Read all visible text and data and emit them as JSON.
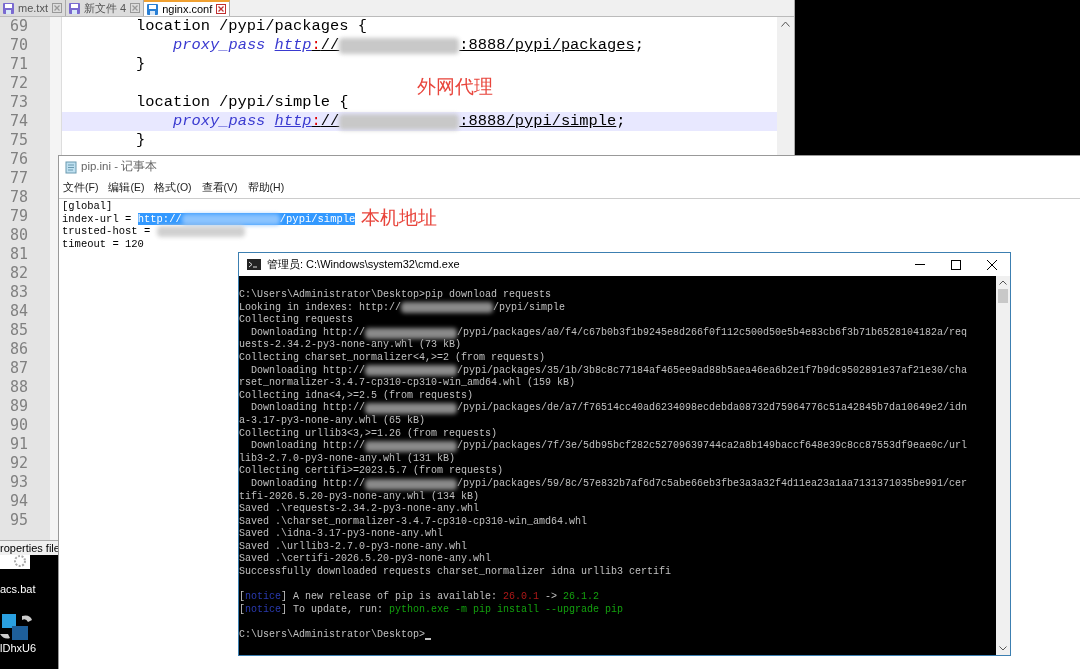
{
  "editor": {
    "tabs": [
      {
        "label": "me.txt",
        "selected": false
      },
      {
        "label": "新文件 4",
        "selected": false
      },
      {
        "label": "nginx.conf",
        "selected": true
      }
    ],
    "lines": [
      {
        "number": "69",
        "kind": "block",
        "selected": false,
        "tokens": [
          {
            "kind": "plain",
            "text": "location /pypi/packages {"
          }
        ]
      },
      {
        "number": "70",
        "kind": "directive",
        "selected": false,
        "tokens": [
          {
            "kind": "keyword",
            "text": "proxy_pass"
          },
          {
            "kind": "scheme",
            "text": "http"
          },
          {
            "kind": "colon",
            "text": ":"
          },
          {
            "kind": "url",
            "text": "//"
          },
          {
            "kind": "redacted"
          },
          {
            "kind": "url",
            "text": ":8888/pypi/packages"
          },
          {
            "kind": "plain",
            "text": ";"
          }
        ]
      },
      {
        "number": "71",
        "kind": "block",
        "selected": false,
        "tokens": [
          {
            "kind": "plain",
            "text": "}"
          }
        ]
      },
      {
        "number": "72",
        "kind": "blank",
        "selected": false
      },
      {
        "number": "73",
        "kind": "block",
        "selected": false,
        "tokens": [
          {
            "kind": "plain",
            "text": "location /pypi/simple {"
          }
        ]
      },
      {
        "number": "74",
        "kind": "directive",
        "selected": true,
        "tokens": [
          {
            "kind": "keyword",
            "text": "proxy_pass"
          },
          {
            "kind": "scheme",
            "text": "http"
          },
          {
            "kind": "colon",
            "text": ":"
          },
          {
            "kind": "url",
            "text": "//"
          },
          {
            "kind": "redacted"
          },
          {
            "kind": "url",
            "text": ":8888/pypi/simple"
          },
          {
            "kind": "plain",
            "text": ";"
          }
        ]
      },
      {
        "number": "75",
        "kind": "block",
        "selected": false,
        "tokens": [
          {
            "kind": "plain",
            "text": "}"
          }
        ]
      }
    ],
    "more_line_numbers": [
      "76",
      "77",
      "78",
      "79",
      "80",
      "81",
      "82",
      "83",
      "84",
      "85",
      "86",
      "87",
      "88",
      "89",
      "90",
      "91",
      "92",
      "93",
      "94",
      "95"
    ],
    "annotation": "外网代理",
    "status_bar": "roperties file"
  },
  "notepad": {
    "title": "pip.ini - 记事本",
    "menu": [
      "文件(F)",
      "编辑(E)",
      "格式(O)",
      "查看(V)",
      "帮助(H)"
    ],
    "lines": [
      [
        {
          "kind": "text",
          "text": "[global]",
          "selected": false
        }
      ],
      [
        {
          "kind": "text",
          "text": "index-url = ",
          "selected": false
        },
        {
          "kind": "text",
          "text": "http://",
          "selected": true
        },
        {
          "kind": "redacted",
          "selected": true
        },
        {
          "kind": "text",
          "text": "/pypi/simple",
          "selected": true
        }
      ],
      [
        {
          "kind": "text",
          "text": "trusted-host = ",
          "selected": false
        },
        {
          "kind": "redacted",
          "selected": false
        }
      ],
      [
        {
          "kind": "text",
          "text": "timeout = 120",
          "selected": false
        }
      ]
    ],
    "annotation": "本机地址"
  },
  "console": {
    "title": "管理员: C:\\Windows\\system32\\cmd.exe",
    "blocks": [
      [
        [
          {
            "kind": "plain",
            "text": "C:\\Users\\Administrator\\Desktop>pip download requests"
          }
        ],
        [
          {
            "kind": "plain",
            "text": "Looking in indexes: http://"
          },
          {
            "kind": "redacted"
          },
          {
            "kind": "plain",
            "text": "/pypi/simple"
          }
        ],
        [
          {
            "kind": "plain",
            "text": "Collecting requests"
          }
        ],
        [
          {
            "kind": "plain",
            "text": "  Downloading http://"
          },
          {
            "kind": "redacted"
          },
          {
            "kind": "plain",
            "text": "/pypi/packages/a0/f4/c67b0b3f1b9245e8d266f0f112c500d50e5b4e83cb6f3b71b6528104182a/req"
          }
        ],
        [
          {
            "kind": "plain",
            "text": "uests-2.34.2-py3-none-any.whl (73 kB)"
          }
        ],
        [
          {
            "kind": "plain",
            "text": "Collecting charset_normalizer<4,>=2 (from requests)"
          }
        ],
        [
          {
            "kind": "plain",
            "text": "  Downloading http://"
          },
          {
            "kind": "redacted"
          },
          {
            "kind": "plain",
            "text": "/pypi/packages/35/1b/3b8c8c77184af465ee9ad88b5aea46ea6b2e1f7b9dc9502891e37af21e30/cha"
          }
        ],
        [
          {
            "kind": "plain",
            "text": "rset_normalizer-3.4.7-cp310-cp310-win_amd64.whl (159 kB)"
          }
        ],
        [
          {
            "kind": "plain",
            "text": "Collecting idna<4,>=2.5 (from requests)"
          }
        ],
        [
          {
            "kind": "plain",
            "text": "  Downloading http://"
          },
          {
            "kind": "redacted"
          },
          {
            "kind": "plain",
            "text": "/pypi/packages/de/a7/f76514cc40ad6234098ecdebda08732d75964776c51a42845b7da10649e2/idn"
          }
        ],
        [
          {
            "kind": "plain",
            "text": "a-3.17-py3-none-any.whl (65 kB)"
          }
        ],
        [
          {
            "kind": "plain",
            "text": "Collecting urllib3<3,>=1.26 (from requests)"
          }
        ],
        [
          {
            "kind": "plain",
            "text": "  Downloading http://"
          },
          {
            "kind": "redacted"
          },
          {
            "kind": "plain",
            "text": "/pypi/packages/7f/3e/5db95bcf282c52709639744ca2a8b149baccf648e39c8cc87553df9eae0c/url"
          }
        ],
        [
          {
            "kind": "plain",
            "text": "lib3-2.7.0-py3-none-any.whl (131 kB)"
          }
        ],
        [
          {
            "kind": "plain",
            "text": "Collecting certifi>=2023.5.7 (from requests)"
          }
        ],
        [
          {
            "kind": "plain",
            "text": "  Downloading http://"
          },
          {
            "kind": "redacted"
          },
          {
            "kind": "plain",
            "text": "/pypi/packages/59/8c/57e832b7af6d7c5abe66eb3fbe3a3a32f4d11ea23a1aa7131371035be991/cer"
          }
        ],
        [
          {
            "kind": "plain",
            "text": "tifi-2026.5.20-py3-none-any.whl (134 kB)"
          }
        ],
        [
          {
            "kind": "plain",
            "text": "Saved .\\requests-2.34.2-py3-none-any.whl"
          }
        ],
        [
          {
            "kind": "plain",
            "text": "Saved .\\charset_normalizer-3.4.7-cp310-cp310-win_amd64.whl"
          }
        ],
        [
          {
            "kind": "plain",
            "text": "Saved .\\idna-3.17-py3-none-any.whl"
          }
        ],
        [
          {
            "kind": "plain",
            "text": "Saved .\\urllib3-2.7.0-py3-none-any.whl"
          }
        ],
        [
          {
            "kind": "plain",
            "text": "Saved .\\certifi-2026.5.20-py3-none-any.whl"
          }
        ],
        [
          {
            "kind": "plain",
            "text": "Successfully downloaded requests charset_normalizer idna urllib3 certifi"
          }
        ]
      ],
      [
        [
          {
            "kind": "plain",
            "text": "["
          },
          {
            "kind": "notice",
            "text": "notice"
          },
          {
            "kind": "plain",
            "text": "] A new release of pip is available: "
          },
          {
            "kind": "old",
            "text": "26.0.1"
          },
          {
            "kind": "plain",
            "text": " -> "
          },
          {
            "kind": "new",
            "text": "26.1.2"
          }
        ],
        [
          {
            "kind": "plain",
            "text": "["
          },
          {
            "kind": "notice",
            "text": "notice"
          },
          {
            "kind": "plain",
            "text": "] To update, run: "
          },
          {
            "kind": "new",
            "text": "python.exe -m pip install --upgrade pip"
          }
        ]
      ],
      [
        [
          {
            "kind": "plain",
            "text": "C:\\Users\\Administrator\\Desktop>"
          },
          {
            "kind": "cursor"
          }
        ]
      ]
    ]
  },
  "desktop": {
    "icons": [
      {
        "kind": "script",
        "label": "acs.bat"
      },
      {
        "kind": "app",
        "label": "lDhxU6"
      }
    ]
  }
}
